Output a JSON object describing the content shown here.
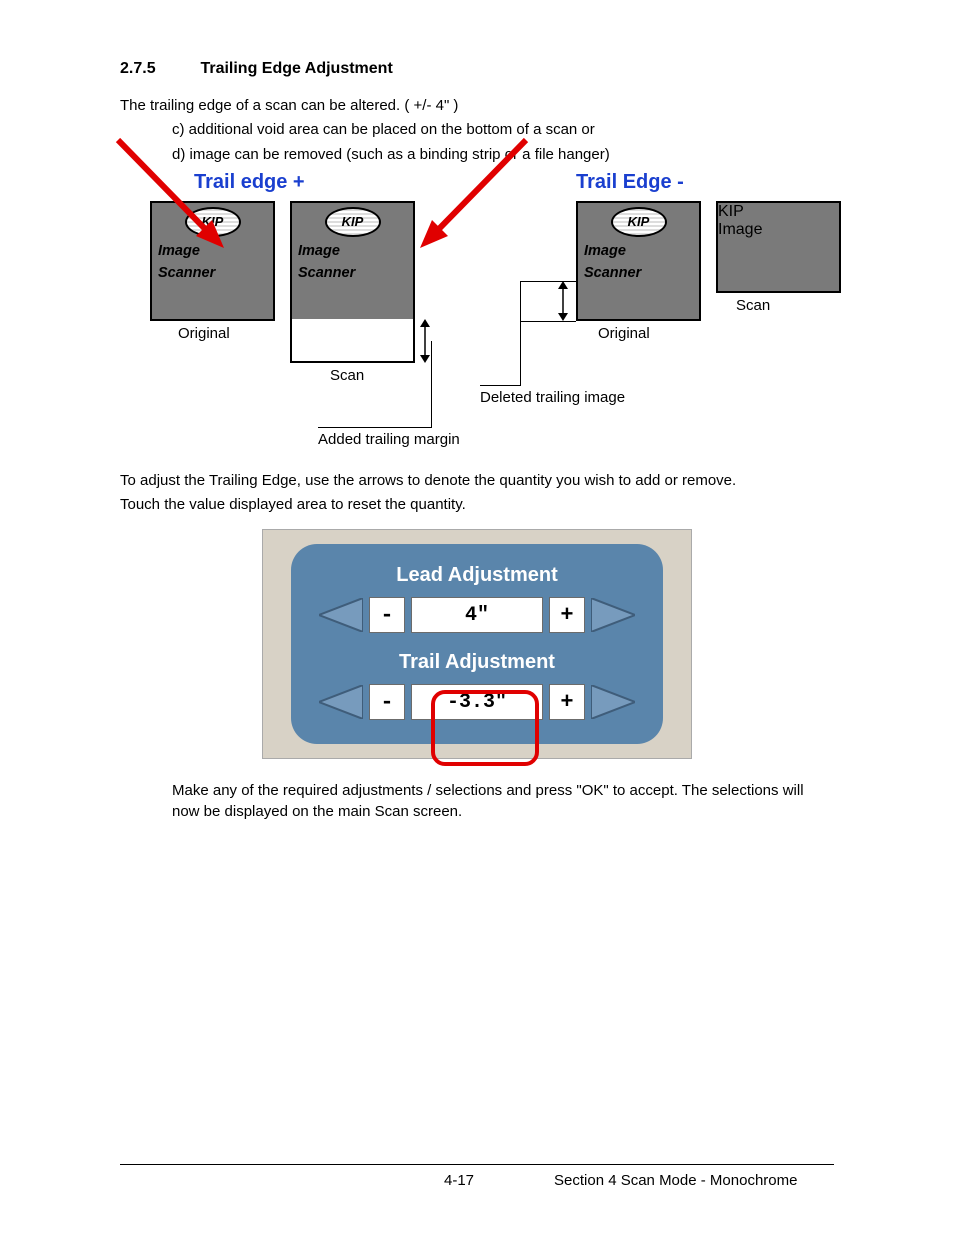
{
  "section_number": "2.7.5",
  "section_title": "Trailing Edge Adjustment",
  "intro": "The trailing edge of a scan can be altered.  ( +/- 4\" )",
  "bullet_c": "c)  additional void area can be placed on the bottom of a scan or",
  "bullet_d": "d)  image can be removed (such as a binding strip or a file hanger)",
  "diag": {
    "left_header": "Trail edge +",
    "right_header": "Trail Edge -",
    "logo": "KIP",
    "line1": "Image",
    "line2": "Scanner",
    "lbl_original": "Original",
    "lbl_scan": "Scan",
    "lbl_added": "Added trailing margin",
    "lbl_deleted": "Deleted trailing image"
  },
  "para2a": "To adjust the Trailing Edge, use the arrows to denote the quantity you wish to add or remove.",
  "para2b": "Touch the value displayed area to reset the quantity.",
  "ui": {
    "lead_title": "Lead Adjustment",
    "lead_value": "4\"",
    "trail_title": "Trail Adjustment",
    "trail_value": "-3.3\"",
    "minus": "-",
    "plus": "+"
  },
  "para3": "Make any of the required adjustments / selections and press \"OK\" to accept. The selections will now be displayed on the main Scan screen.",
  "footer": {
    "page": "4-17",
    "section": "Section 4    Scan Mode - Monochrome"
  }
}
